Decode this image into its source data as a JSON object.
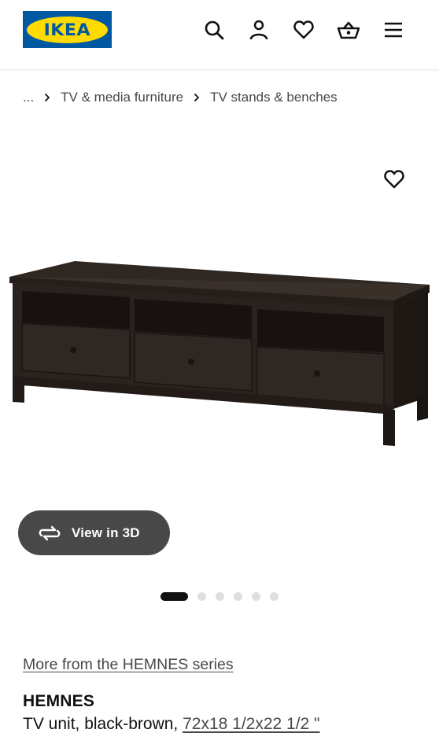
{
  "header": {
    "logo_text": "IKEA",
    "icons": [
      "search-icon",
      "account-icon",
      "heart-icon",
      "cart-icon",
      "menu-icon"
    ]
  },
  "breadcrumb": {
    "ellipsis": "...",
    "items": [
      "TV & media furniture",
      "TV stands & benches"
    ]
  },
  "gallery": {
    "view_3d_label": "View in 3D",
    "dot_count": 6,
    "active_index": 0
  },
  "product": {
    "series_link": "More from the HEMNES series",
    "name": "HEMNES",
    "description": "TV unit, black-brown,",
    "size": "72x18 1/2x22 1/2 \""
  },
  "colors": {
    "ikea_blue": "#0058a3",
    "ikea_yellow": "#ffdb00",
    "button_dark": "#484848",
    "furniture": "#2b2420"
  }
}
